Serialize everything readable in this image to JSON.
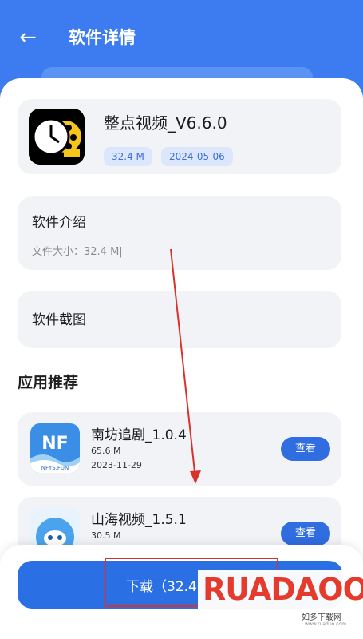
{
  "header": {
    "back_icon": "arrow-left-icon",
    "title": "软件详情"
  },
  "app": {
    "name": "整点视频_V6.6.0",
    "size": "32.4 M",
    "date": "2024-05-06",
    "icon": "clock-film-icon"
  },
  "intro": {
    "title": "软件介绍",
    "file_size": "文件大小：32.4 M|"
  },
  "screenshots": {
    "title": "软件截图"
  },
  "recommend": {
    "title": "应用推荐",
    "items": [
      {
        "name": "南坊追剧_1.0.4",
        "size": "65.6 M",
        "date": "2023-11-29",
        "button": "查看",
        "icon_text": "NF",
        "icon_sub": "NFYS.FUN"
      },
      {
        "name": "山海视频_1.5.1",
        "size": "30.5 M",
        "date": "",
        "button": "查看"
      }
    ]
  },
  "download": {
    "label": "下载（32.4"
  },
  "watermark": {
    "text": "RUADAOO",
    "sub": "如多下载网",
    "url": "www.ruaduo.com"
  },
  "colors": {
    "primary": "#3d7cf0",
    "button": "#2b6fe5",
    "annotation": "#d9322b"
  }
}
